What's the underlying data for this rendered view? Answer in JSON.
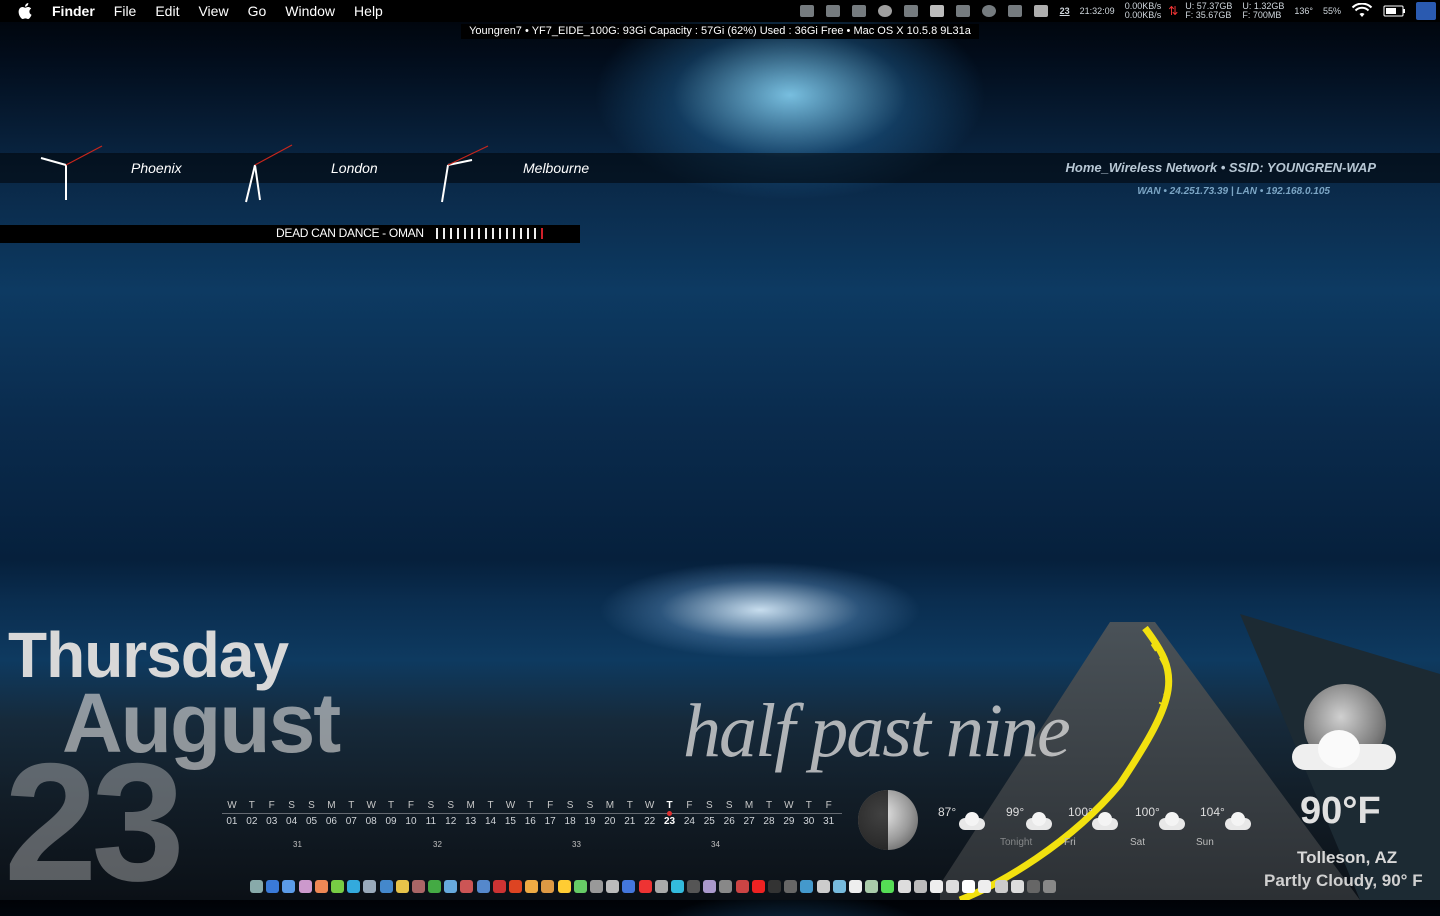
{
  "menubar": {
    "app_name": "Finder",
    "menus": [
      "File",
      "Edit",
      "View",
      "Go",
      "Window",
      "Help"
    ]
  },
  "status": {
    "date_badge": "23",
    "time": "21:32:09",
    "net_up": "0.00KB/s",
    "net_down": "0.00KB/s",
    "disk1_u": "U: 57.37GB",
    "disk1_f": "F: 35.67GB",
    "disk2_u": "U: 1.32GB",
    "disk2_f": "F: 700MB",
    "temp": "136°",
    "battery": "55%"
  },
  "sysinfo": "Youngren7 • YF7_EIDE_100G: 93Gi Capacity : 57Gi (62%) Used : 36Gi Free • Mac OS X 10.5.8 9L31a",
  "clocks": [
    {
      "city": "Phoenix"
    },
    {
      "city": "London"
    },
    {
      "city": "Melbourne"
    }
  ],
  "network": {
    "name": "Home_Wireless Network • SSID: YOUNGREN-WAP",
    "ips": "WAN • 24.251.73.39 | LAN • 192.168.0.105"
  },
  "now_playing": {
    "track": "DEAD CAN DANCE - OMAN",
    "progress_bars": 16,
    "progress_current": 16
  },
  "date": {
    "day": "Thursday",
    "month": "August",
    "number": "23"
  },
  "time_words": "half past nine",
  "calendar": {
    "days_of_week": [
      "W",
      "T",
      "F",
      "S",
      "S",
      "M",
      "T",
      "W",
      "T",
      "F",
      "S",
      "S",
      "M",
      "T",
      "W",
      "T",
      "F",
      "S",
      "S",
      "M",
      "T",
      "W",
      "T",
      "F",
      "S",
      "S",
      "M",
      "T",
      "W",
      "T",
      "F"
    ],
    "dates": [
      "01",
      "02",
      "03",
      "04",
      "05",
      "06",
      "07",
      "08",
      "09",
      "10",
      "11",
      "12",
      "13",
      "14",
      "15",
      "16",
      "17",
      "18",
      "19",
      "20",
      "21",
      "22",
      "23",
      "24",
      "25",
      "26",
      "27",
      "28",
      "29",
      "30",
      "31"
    ],
    "today_index": 22,
    "week_numbers": [
      "31",
      "32",
      "33",
      "34"
    ]
  },
  "forecast": [
    {
      "temp": "87°",
      "day": ""
    },
    {
      "temp": "99°",
      "day": "Tonight"
    },
    {
      "temp": "100°",
      "day": "Fri"
    },
    {
      "temp": "100°",
      "day": "Sat"
    },
    {
      "temp": "104°",
      "day": "Sun"
    }
  ],
  "weather": {
    "current_temp": "90°F",
    "location": "Tolleson, AZ",
    "condition": "Partly Cloudy, 90° F"
  },
  "colors": {
    "accent_red": "#d0202a",
    "road_line": "#f2e10f"
  }
}
